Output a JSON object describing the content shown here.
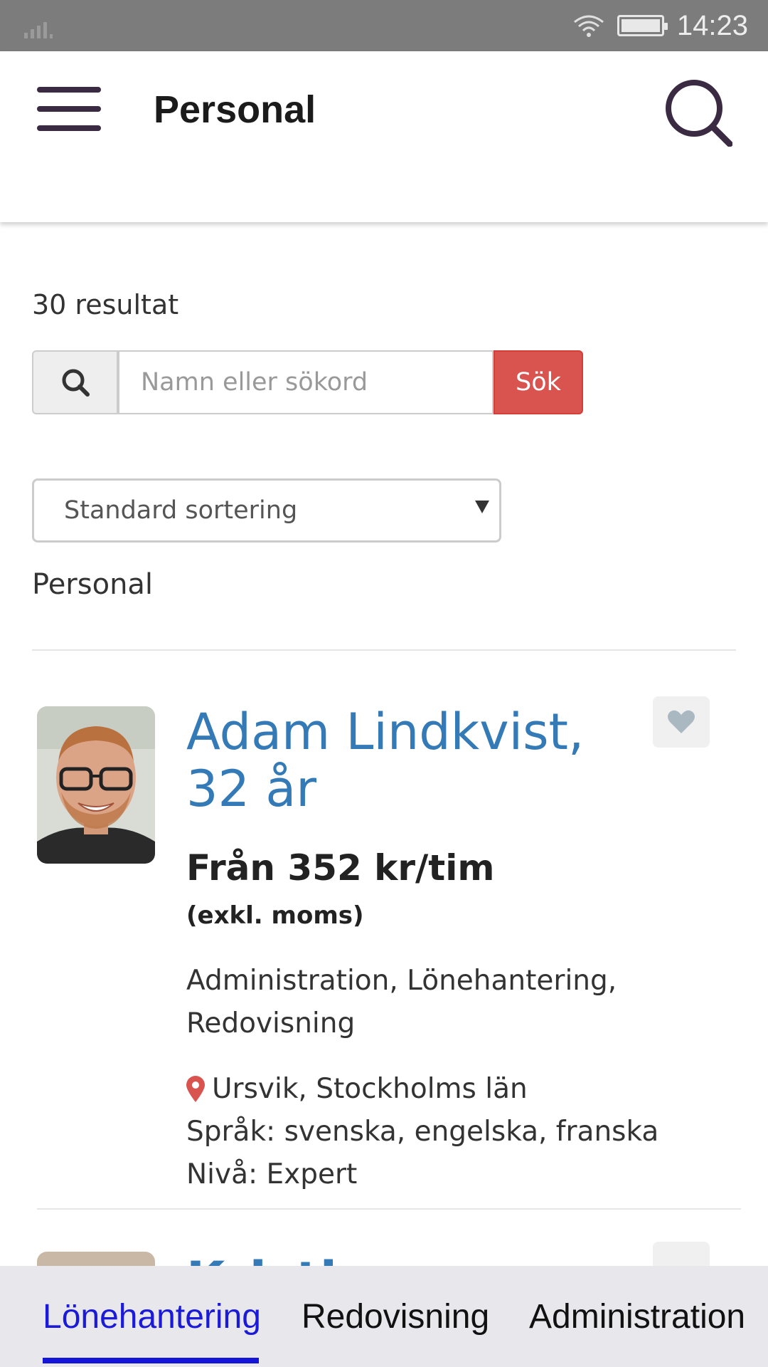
{
  "status_bar": {
    "time": "14:23"
  },
  "app_bar": {
    "title": "Personal"
  },
  "results": {
    "count_text": "30 resultat"
  },
  "search": {
    "placeholder": "Namn eller sökord",
    "button_label": "Sök"
  },
  "sort": {
    "selected": "Standard sortering"
  },
  "section": {
    "label": "Personal"
  },
  "listing": {
    "name": "Adam Lindkvist, 32 år",
    "price": "Från 352 kr/tim",
    "vat_note": "(exkl. moms)",
    "skills": "Administration, Lönehantering, Redovisning",
    "location": "Ursvik, Stockholms län",
    "languages": "Språk: svenska, engelska, franska",
    "level": "Nivå: Expert"
  },
  "next_listing": {
    "partial_name": "Kristina Lindqvist"
  },
  "tabs": [
    {
      "label": "Lönehantering",
      "active": true
    },
    {
      "label": "Redovisning",
      "active": false
    },
    {
      "label": "Administration",
      "active": false
    }
  ],
  "colors": {
    "accent_link": "#337ab7",
    "search_button": "#d9534f",
    "active_tab": "#1a1ad8",
    "status_bar": "#7c7c7c",
    "icon_dark": "#3a2a42"
  },
  "icons": [
    "signal-icon",
    "wifi-icon",
    "battery-icon",
    "menu-icon",
    "search-icon",
    "heart-icon",
    "map-pin-icon",
    "dropdown-arrow-icon"
  ]
}
